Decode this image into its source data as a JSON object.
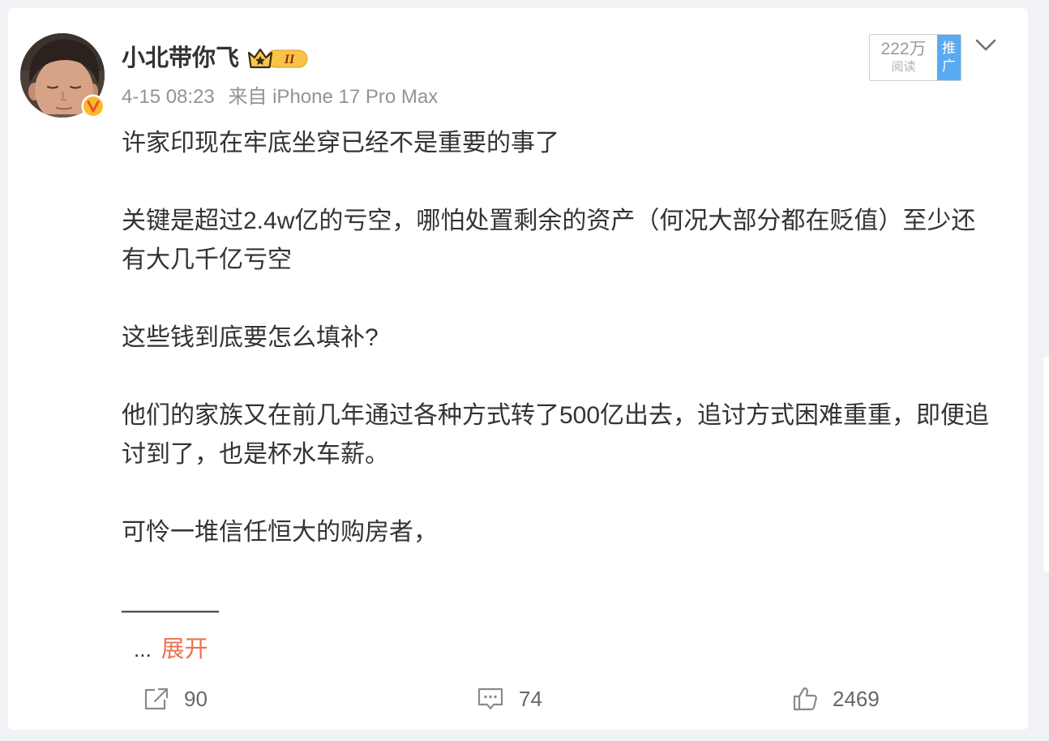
{
  "post": {
    "author": {
      "name": "小北带你飞",
      "member_level": "II",
      "avatar_icon": "avatar-photo",
      "verified_icon": "verified-v-icon",
      "member_icon": "crown-member-icon"
    },
    "meta": {
      "time": "4-15 08:23",
      "source": "来自 iPhone 17 Pro Max"
    },
    "promo": {
      "reads": "222万",
      "reads_label": "阅读",
      "tag_line1": "推",
      "tag_line2": "广"
    },
    "body": {
      "paragraphs": [
        [
          "许家印现在牢底坐穿已经不是重要的事了"
        ],
        [
          "关键是超过2.4w亿的亏空，哪怕处置剩余的资产（何况大部分都在贬值）至少还",
          "有大几千亿亏空"
        ],
        [
          "这些钱到底要怎么填补?"
        ],
        [
          "他们的家族又在前几年通过各种方式转了500亿出去，追讨方式困难重重，即便追",
          "讨到了，也是杯水车薪。"
        ],
        [
          "可怜一堆信任恒大的购房者，"
        ],
        [
          "————"
        ]
      ],
      "ellipsis": "...",
      "expand_label": "展开"
    },
    "actions": {
      "share_count": "90",
      "comment_count": "74",
      "like_count": "2469",
      "share_icon": "share-icon",
      "comment_icon": "comment-icon",
      "like_icon": "thumbs-up-icon",
      "menu_icon": "chevron-down-icon"
    }
  },
  "colors": {
    "text_primary": "#333333",
    "text_secondary": "#939393",
    "expand_link": "#eb7350",
    "promo_tag": "#5aa9f3",
    "verified_badge": "#fbb830",
    "page_background": "#f1f2f5"
  }
}
